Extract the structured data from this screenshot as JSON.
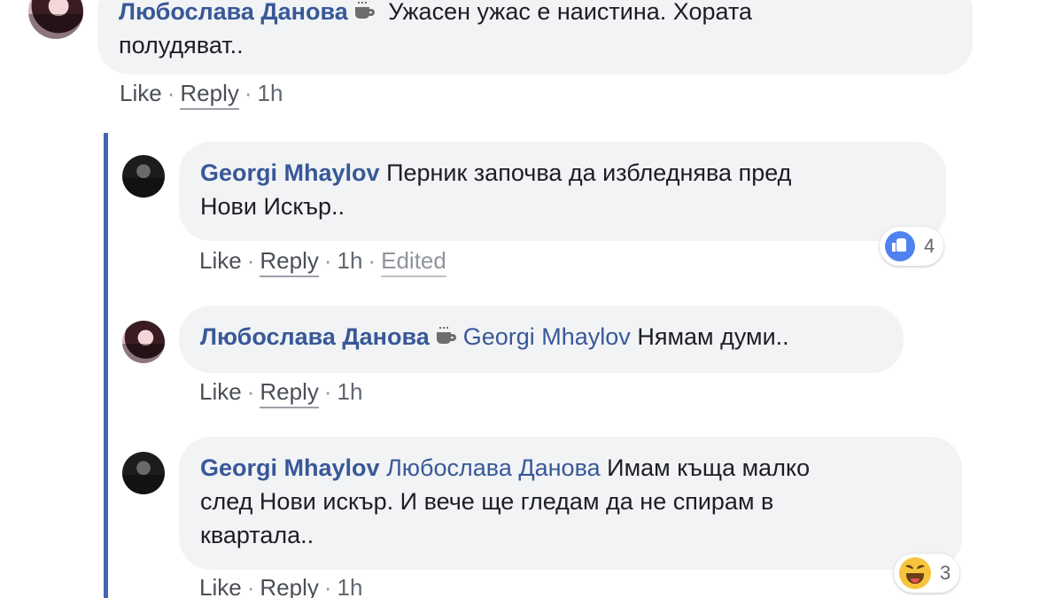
{
  "comments": [
    {
      "author": "Любослава Данова",
      "badge_icon": "coffee-cup-icon",
      "mention": "",
      "text_line1": "Ужасен ужас е наистина. Хората",
      "text_line2": "полудяват..",
      "actions": {
        "like": "Like",
        "reply": "Reply",
        "time": "1h",
        "edited": ""
      }
    },
    {
      "author": "Georgi Mhaylov",
      "mention": "",
      "text_line1": "Перник започва да избледнява пред",
      "text_line2": "Нови Искър..",
      "actions": {
        "like": "Like",
        "reply": "Reply",
        "time": "1h",
        "edited": "Edited"
      },
      "reaction": {
        "icon": "like-reaction-icon",
        "count": "4"
      }
    },
    {
      "author": "Любослава Данова",
      "badge_icon": "coffee-cup-icon",
      "mention": "Georgi Mhaylov",
      "text_line1": "Нямам думи..",
      "actions": {
        "like": "Like",
        "reply": "Reply",
        "time": "1h"
      }
    },
    {
      "author": "Georgi Mhaylov",
      "mention": "Любослава Данова",
      "text_line1": "Имам къща малко",
      "text_line2": "след Нови искър. И вече ще гледам да не спирам в",
      "text_line3": "квартала..",
      "actions": {
        "like": "Like",
        "reply": "Reply",
        "time": "1h"
      },
      "reaction": {
        "icon": "haha-reaction-icon",
        "count": "3"
      }
    }
  ],
  "separator": "·",
  "colors": {
    "author": "#385898",
    "bubble": "#f2f3f5",
    "thread_line": "#4267b2",
    "like": "#4f82f0",
    "haha": "#f7c53d"
  }
}
